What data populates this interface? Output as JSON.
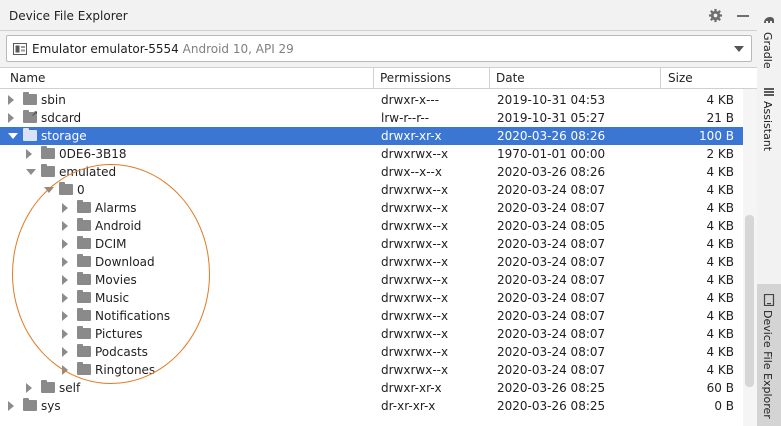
{
  "window": {
    "title": "Device File Explorer"
  },
  "device": {
    "name": "Emulator emulator-5554",
    "info": "Android 10, API 29"
  },
  "columns": {
    "name": "Name",
    "permissions": "Permissions",
    "date": "Date",
    "size": "Size"
  },
  "rows": [
    {
      "name": "sbin",
      "permissions": "drwxr-x---",
      "date": "2019-10-31 04:53",
      "size": "4 KB",
      "depth": 0,
      "state": "collapsed",
      "link": false,
      "selected": false
    },
    {
      "name": "sdcard",
      "permissions": "lrw-r--r--",
      "date": "2019-10-31 05:27",
      "size": "21 B",
      "depth": 0,
      "state": "collapsed",
      "link": true,
      "selected": false
    },
    {
      "name": "storage",
      "permissions": "drwxr-xr-x",
      "date": "2020-03-26 08:26",
      "size": "100 B",
      "depth": 0,
      "state": "expanded",
      "link": false,
      "selected": true
    },
    {
      "name": "0DE6-3B18",
      "permissions": "drwxrwx--x",
      "date": "1970-01-01 00:00",
      "size": "2 KB",
      "depth": 1,
      "state": "collapsed",
      "link": false,
      "selected": false
    },
    {
      "name": "emulated",
      "permissions": "drwx--x--x",
      "date": "2020-03-26 08:26",
      "size": "4 KB",
      "depth": 1,
      "state": "expanded",
      "link": false,
      "selected": false
    },
    {
      "name": "0",
      "permissions": "drwxrwx--x",
      "date": "2020-03-24 08:07",
      "size": "4 KB",
      "depth": 2,
      "state": "expanded",
      "link": false,
      "selected": false
    },
    {
      "name": "Alarms",
      "permissions": "drwxrwx--x",
      "date": "2020-03-24 08:07",
      "size": "4 KB",
      "depth": 3,
      "state": "collapsed",
      "link": false,
      "selected": false
    },
    {
      "name": "Android",
      "permissions": "drwxrwx--x",
      "date": "2020-03-24 08:05",
      "size": "4 KB",
      "depth": 3,
      "state": "collapsed",
      "link": false,
      "selected": false
    },
    {
      "name": "DCIM",
      "permissions": "drwxrwx--x",
      "date": "2020-03-24 08:07",
      "size": "4 KB",
      "depth": 3,
      "state": "collapsed",
      "link": false,
      "selected": false
    },
    {
      "name": "Download",
      "permissions": "drwxrwx--x",
      "date": "2020-03-24 08:07",
      "size": "4 KB",
      "depth": 3,
      "state": "collapsed",
      "link": false,
      "selected": false
    },
    {
      "name": "Movies",
      "permissions": "drwxrwx--x",
      "date": "2020-03-24 08:07",
      "size": "4 KB",
      "depth": 3,
      "state": "collapsed",
      "link": false,
      "selected": false
    },
    {
      "name": "Music",
      "permissions": "drwxrwx--x",
      "date": "2020-03-24 08:07",
      "size": "4 KB",
      "depth": 3,
      "state": "collapsed",
      "link": false,
      "selected": false
    },
    {
      "name": "Notifications",
      "permissions": "drwxrwx--x",
      "date": "2020-03-24 08:07",
      "size": "4 KB",
      "depth": 3,
      "state": "collapsed",
      "link": false,
      "selected": false
    },
    {
      "name": "Pictures",
      "permissions": "drwxrwx--x",
      "date": "2020-03-24 08:07",
      "size": "4 KB",
      "depth": 3,
      "state": "collapsed",
      "link": false,
      "selected": false
    },
    {
      "name": "Podcasts",
      "permissions": "drwxrwx--x",
      "date": "2020-03-24 08:07",
      "size": "4 KB",
      "depth": 3,
      "state": "collapsed",
      "link": false,
      "selected": false
    },
    {
      "name": "Ringtones",
      "permissions": "drwxrwx--x",
      "date": "2020-03-24 08:07",
      "size": "4 KB",
      "depth": 3,
      "state": "collapsed",
      "link": false,
      "selected": false
    },
    {
      "name": "self",
      "permissions": "drwxr-xr-x",
      "date": "2020-03-26 08:25",
      "size": "60 B",
      "depth": 1,
      "state": "collapsed",
      "link": false,
      "selected": false
    },
    {
      "name": "sys",
      "permissions": "dr-xr-xr-x",
      "date": "2020-03-26 08:25",
      "size": "0 B",
      "depth": 0,
      "state": "collapsed",
      "link": false,
      "selected": false
    }
  ],
  "side_tabs": {
    "gradle": "Gradle",
    "assistant": "Assistant",
    "device_file_explorer": "Device File Explorer"
  },
  "colors": {
    "selection": "#3a76d2",
    "annotation": "#e07b24"
  },
  "icons": {
    "settings": "gear-icon",
    "minimize": "minimize-icon",
    "device": "device-icon",
    "folder": "folder-icon"
  }
}
